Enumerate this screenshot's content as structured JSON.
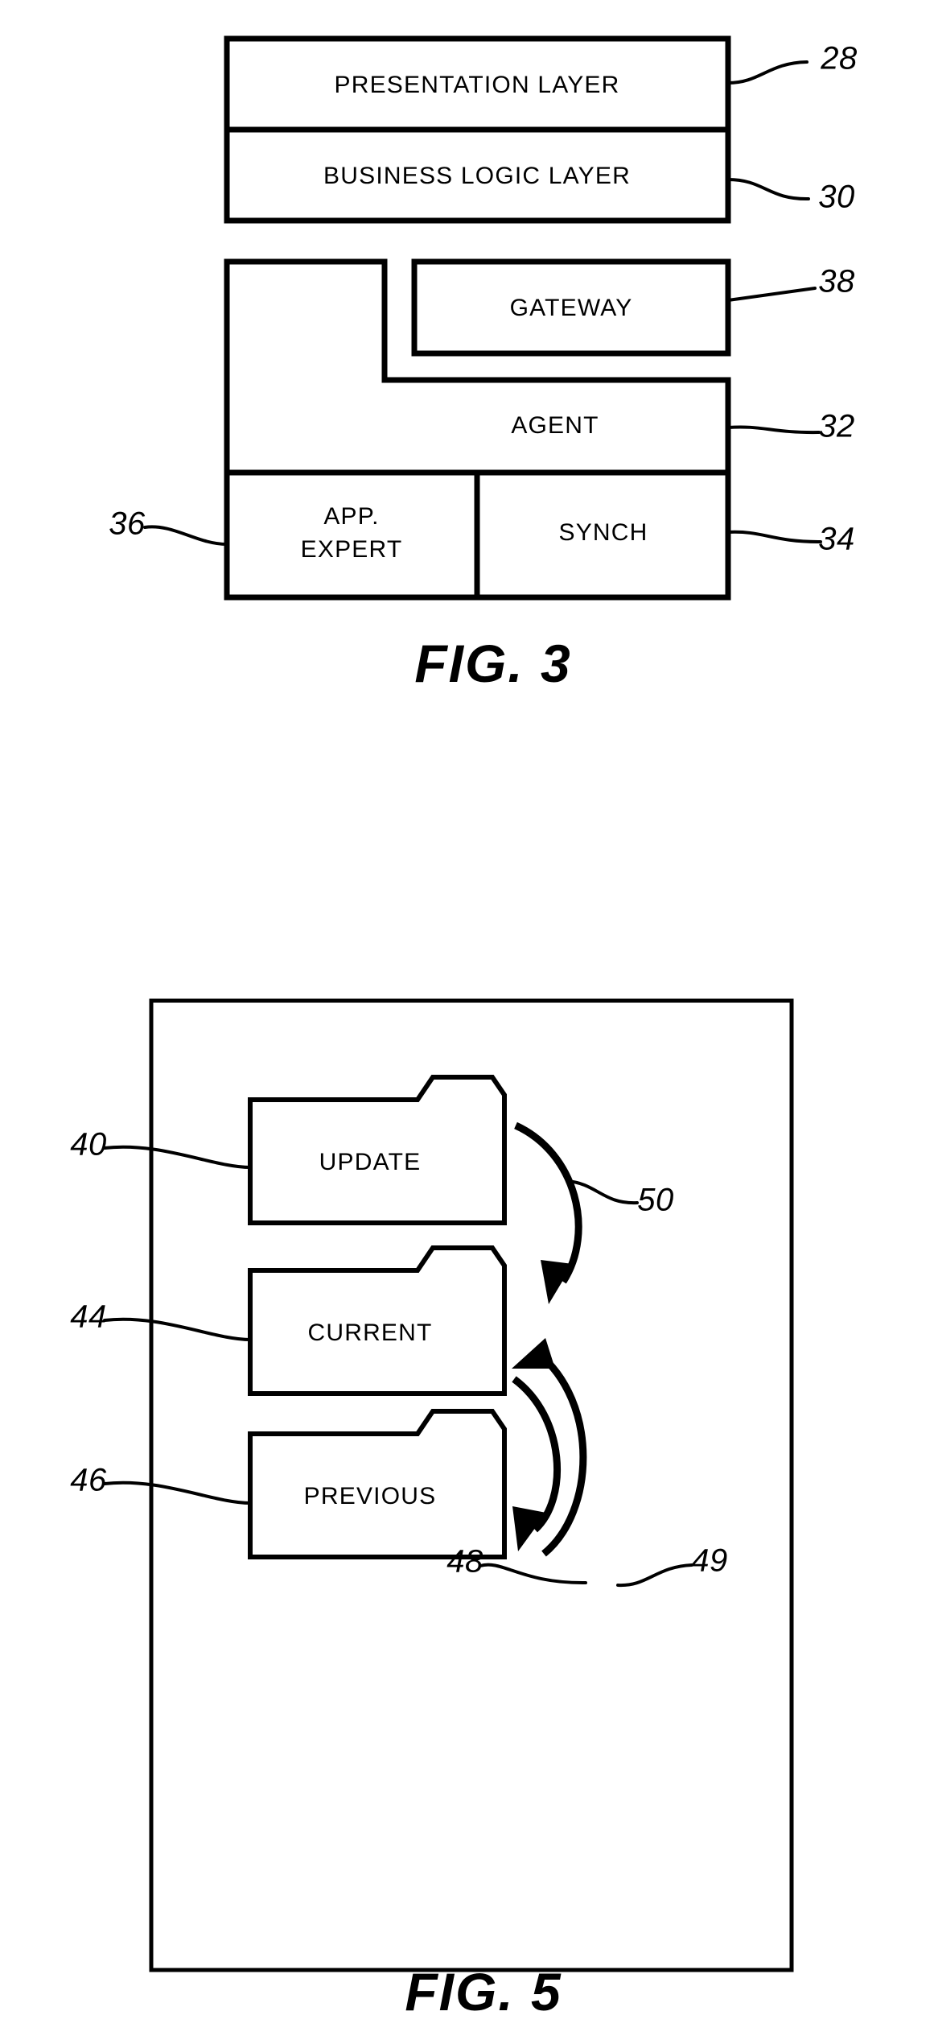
{
  "figures": [
    {
      "id": "fig3",
      "caption": "FIG.  3",
      "blocks": [
        {
          "key": "presentation_layer",
          "label": "PRESENTATION LAYER",
          "ref": "28"
        },
        {
          "key": "business_logic_layer",
          "label": "BUSINESS LOGIC LAYER",
          "ref": "30"
        },
        {
          "key": "gateway",
          "label": "GATEWAY",
          "ref": "38"
        },
        {
          "key": "agent",
          "label": "AGENT",
          "ref": "32"
        },
        {
          "key": "app_expert",
          "label_line1": "APP.",
          "label_line2": "EXPERT",
          "ref": "36"
        },
        {
          "key": "synch",
          "label": "SYNCH",
          "ref": "34"
        }
      ],
      "refs": {
        "r28": "28",
        "r30": "30",
        "r38": "38",
        "r32": "32",
        "r34": "34",
        "r36": "36"
      }
    },
    {
      "id": "fig5",
      "caption": "FIG.  5",
      "folders": [
        {
          "key": "update",
          "label": "UPDATE",
          "ref": "40"
        },
        {
          "key": "current",
          "label": "CURRENT",
          "ref": "44"
        },
        {
          "key": "previous",
          "label": "PREVIOUS",
          "ref": "46"
        }
      ],
      "refs": {
        "r40": "40",
        "r44": "44",
        "r46": "46",
        "r48": "48",
        "r49": "49",
        "r50": "50"
      }
    }
  ],
  "colors": {
    "ink": "#000000",
    "paper": "#ffffff"
  }
}
